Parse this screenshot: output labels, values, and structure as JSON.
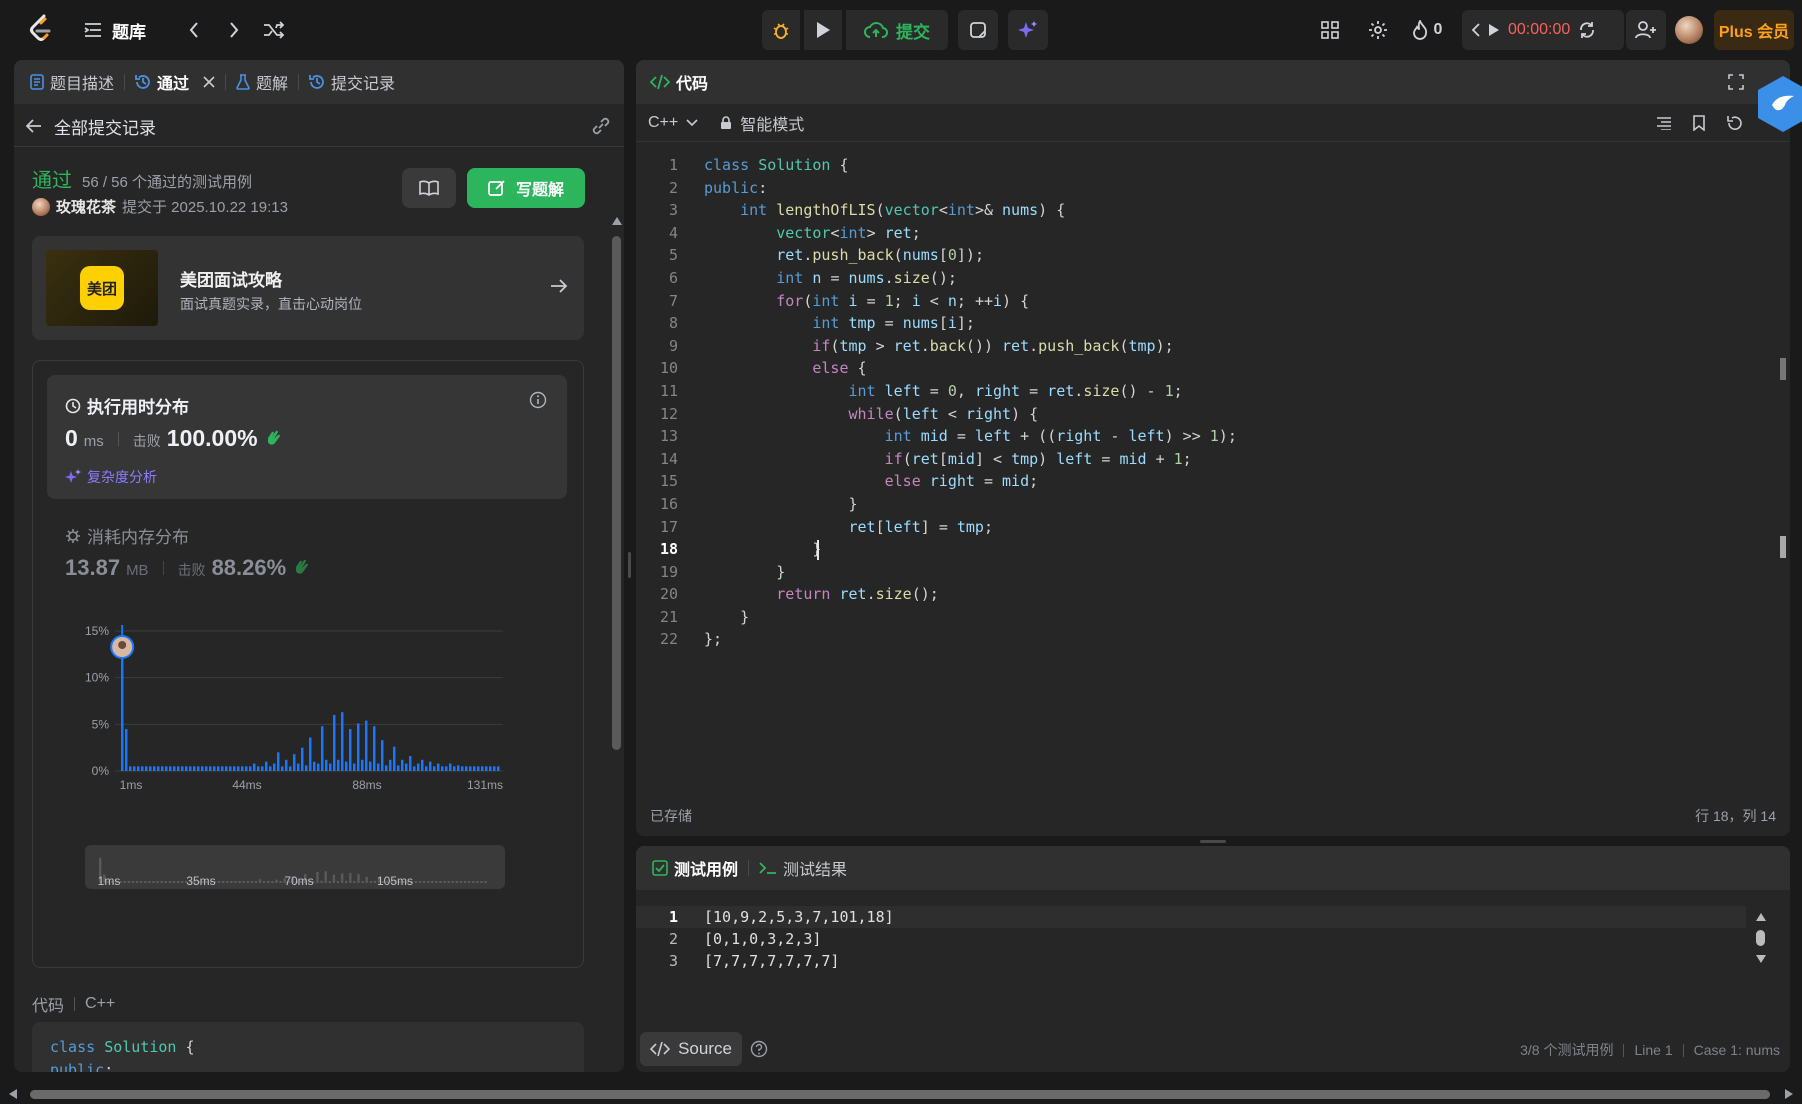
{
  "topbar": {
    "problem_bank": "题库",
    "submit_label": "提交",
    "streak_count": "0",
    "timer": "00:00:00",
    "plus_label": "Plus 会员"
  },
  "left_panel": {
    "tabs": [
      {
        "label": "题目描述",
        "icon": "description-icon"
      },
      {
        "label": "通过",
        "icon": "history-icon",
        "active": true
      },
      {
        "label": "题解",
        "icon": "flask-icon"
      },
      {
        "label": "提交记录",
        "icon": "history-icon"
      }
    ],
    "back_label": "全部提交记录",
    "status": "通过",
    "testcases_passed": "56 / 56 个通过的测试用例",
    "user_name": "玫瑰花茶",
    "submitted_at": "提交于 2025.10.22 19:13",
    "write_solution_label": "写题解",
    "promo": {
      "badge": "美团",
      "title": "美团面试攻略",
      "subtitle": "面试真题实录，直击心动岗位"
    },
    "runtime": {
      "title": "执行用时分布",
      "value": "0",
      "unit": "ms",
      "beats_label": "击败",
      "beats": "100.00%",
      "analysis_label": "复杂度分析"
    },
    "memory": {
      "title": "消耗内存分布",
      "value": "13.87",
      "unit": "MB",
      "beats_label": "击败",
      "beats": "88.26%"
    },
    "code_label": "代码",
    "code_lang": "C++",
    "code_preview": [
      "class Solution {",
      "public:"
    ]
  },
  "chart_data": {
    "type": "bar",
    "title": "执行用时分布",
    "ylim": [
      0,
      15
    ],
    "y_ticks": [
      "15%",
      "10%",
      "5%",
      "0%"
    ],
    "x_ticks": [
      "1ms",
      "44ms",
      "88ms",
      "131ms"
    ],
    "nav_ticks": [
      "1ms",
      "35ms",
      "70ms",
      "105ms"
    ],
    "highlight_index": 0,
    "values": [
      13.5,
      4.5,
      0.5,
      0.5,
      0.5,
      0.5,
      0.5,
      0.5,
      0.5,
      0.5,
      0.5,
      0.5,
      0.5,
      0.5,
      0.5,
      0.5,
      0.5,
      0.5,
      0.5,
      0.5,
      0.5,
      0.5,
      0.5,
      0.5,
      0.5,
      0.5,
      0.5,
      0.5,
      0.5,
      0.5,
      0.5,
      0.5,
      0.5,
      0.8,
      0.5,
      0.5,
      1.0,
      0.5,
      0.8,
      2.0,
      0.5,
      1.2,
      0.5,
      1.8,
      0.8,
      2.5,
      0.6,
      3.6,
      1.0,
      0.8,
      4.8,
      1.2,
      0.8,
      6.0,
      1.2,
      6.3,
      1.0,
      4.5,
      0.8,
      5.1,
      1.2,
      5.4,
      1.0,
      4.8,
      0.8,
      3.3,
      0.6,
      1.2,
      2.6,
      0.6,
      1.2,
      0.8,
      1.6,
      0.5,
      0.8,
      1.2,
      0.5,
      1.0,
      0.5,
      0.8,
      0.5,
      0.5,
      0.8,
      0.5,
      0.6,
      0.5,
      0.5,
      0.5,
      0.5,
      0.5,
      0.5,
      0.5,
      0.5,
      0.5,
      0.5
    ]
  },
  "editor": {
    "title": "代码",
    "language": "C++",
    "mode_label": "智能模式",
    "saved_label": "已存储",
    "cursor_pos": "行 18，列 14",
    "active_line": 18,
    "lines": [
      "class Solution {",
      "public:",
      "    int lengthOfLIS(vector<int>& nums) {",
      "        vector<int> ret;",
      "        ret.push_back(nums[0]);",
      "        int n = nums.size();",
      "        for(int i = 1; i < n; ++i) {",
      "            int tmp = nums[i];",
      "            if(tmp > ret.back()) ret.push_back(tmp);",
      "            else {",
      "                int left = 0, right = ret.size() - 1;",
      "                while(left < right) {",
      "                    int mid = left + ((right - left) >> 1);",
      "                    if(ret[mid] < tmp) left = mid + 1;",
      "                    else right = mid;",
      "                }",
      "                ret[left] = tmp;",
      "            }",
      "        }",
      "        return ret.size();",
      "    }",
      "};"
    ]
  },
  "testcase": {
    "tab_cases": "测试用例",
    "tab_results": "测试结果",
    "cases": [
      "[10,9,2,5,3,7,101,18]",
      "[0,1,0,3,2,3]",
      "[7,7,7,7,7,7,7]"
    ],
    "source_label": "Source",
    "footer_count": "3/8 个测试用例",
    "footer_line": "Line 1",
    "footer_case": "Case 1: nums"
  }
}
